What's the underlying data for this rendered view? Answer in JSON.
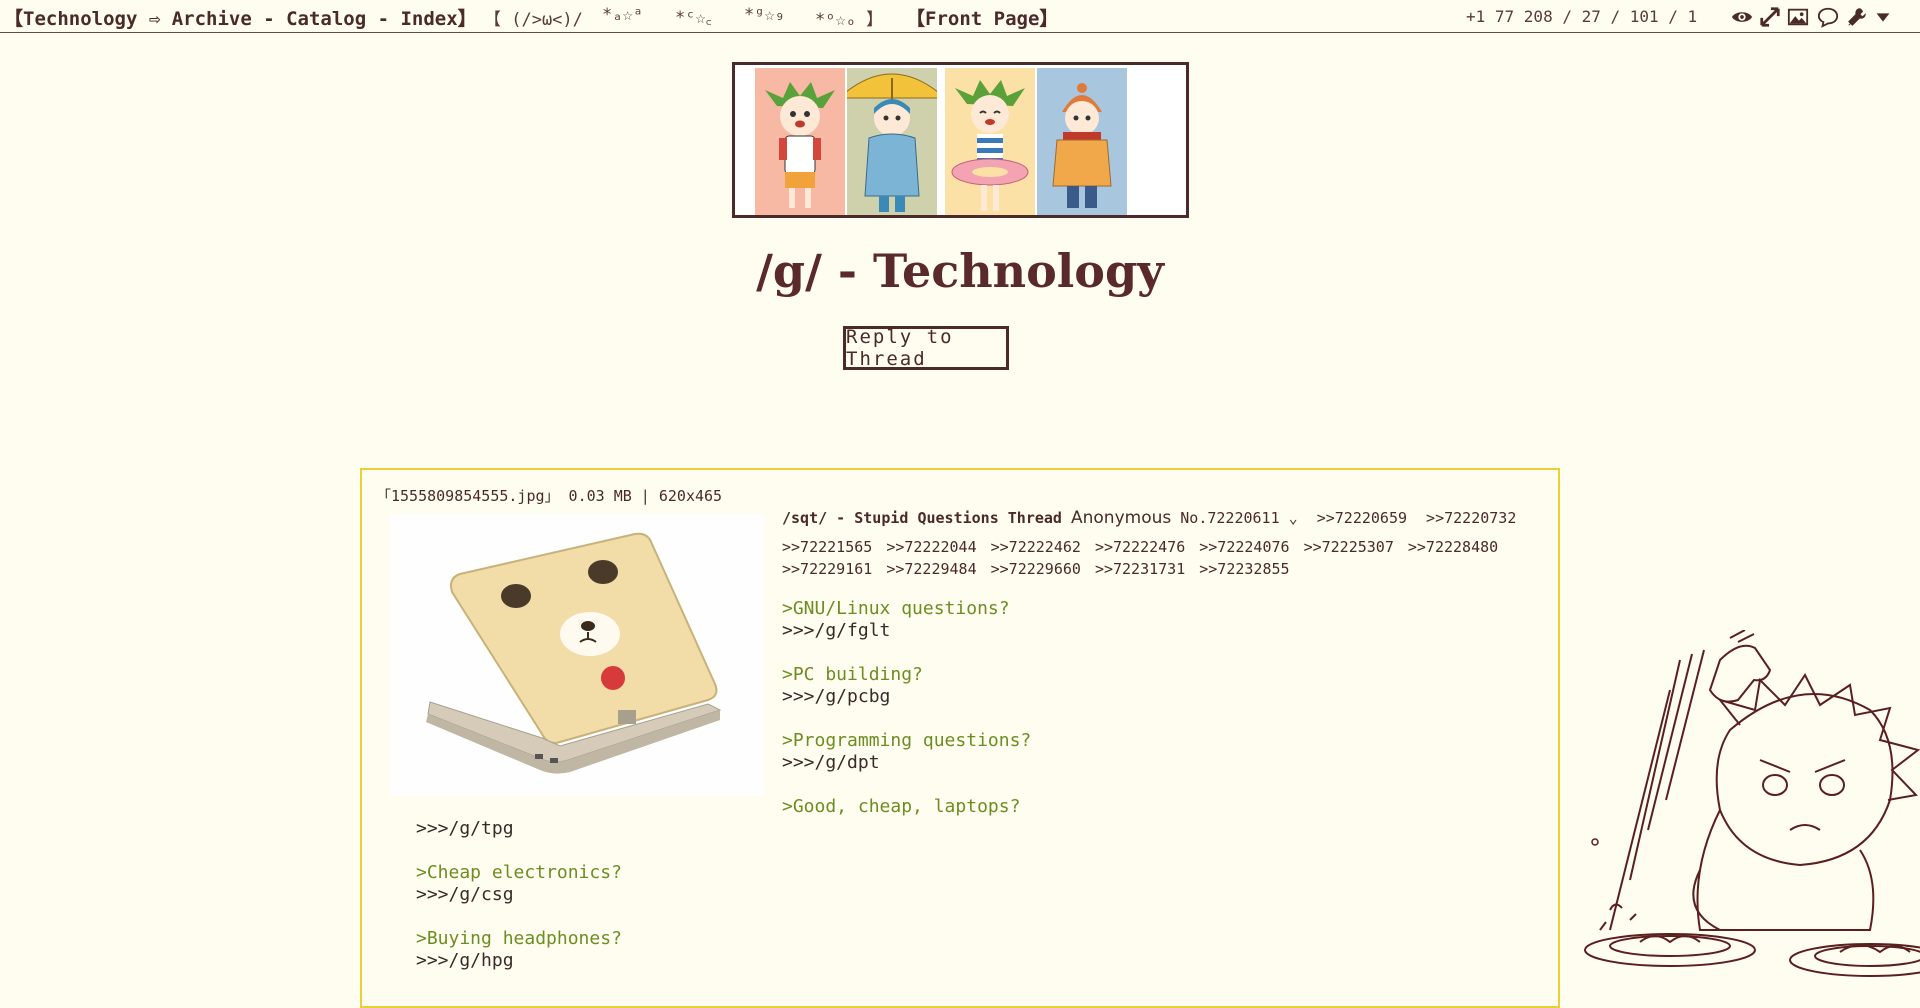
{
  "nav": {
    "left_text": "【Technology ⇨ Archive - Catalog - Index】",
    "deco": [
      "【 (/>ω<)/",
      "*ₐ☆ᵃ",
      "*ᶜ☆꜀",
      "*ᵍ☆₉",
      "*ᵒ☆ₒ 】"
    ],
    "front_page": "【Front Page】",
    "stats": "+1 77 208 / 27 / 101 / 1",
    "icons": [
      "eye-icon",
      "expand-icon",
      "image-icon",
      "speech-bubble-icon",
      "wrench-icon",
      "dropdown-arrow-icon"
    ]
  },
  "board_title": "/g/ - Technology",
  "reply_button": "Reply to Thread",
  "post": {
    "file_info": "「1555809854555.jpg」 0.03 MB | 620x465",
    "subject": "/sqt/ - Stupid Questions Thread",
    "name": "Anonymous",
    "post_number": "No.72220611",
    "inline_replies": [
      ">>72220659",
      ">>72220732"
    ],
    "backlinks": [
      ">>72221565",
      ">>72222044",
      ">>72222462",
      ">>72222476",
      ">>72224076",
      ">>72225307",
      ">>72228480",
      ">>72229161",
      ">>72229484",
      ">>72229660",
      ">>72231731",
      ">>72232855"
    ],
    "body_right": [
      {
        "green": ">GNU/Linux questions?",
        "link": ">>>/g/fglt"
      },
      {
        "green": ">PC building?",
        "link": ">>>/g/pcbg"
      },
      {
        "green": ">Programming questions?",
        "link": ">>>/g/dpt"
      },
      {
        "green": ">Good, cheap, laptops?",
        "link": ""
      }
    ],
    "body_left_top_link": ">>>/g/tpg",
    "body_left": [
      {
        "green": ">Cheap electronics?",
        "link": ">>>/g/csg"
      },
      {
        "green": ">Buying headphones?",
        "link": ">>>/g/hpg"
      }
    ]
  },
  "colors": {
    "background": "#fffdf0",
    "text": "#4a2a2a",
    "greentext": "#6b8e23",
    "post_border": "#e8d23a"
  }
}
